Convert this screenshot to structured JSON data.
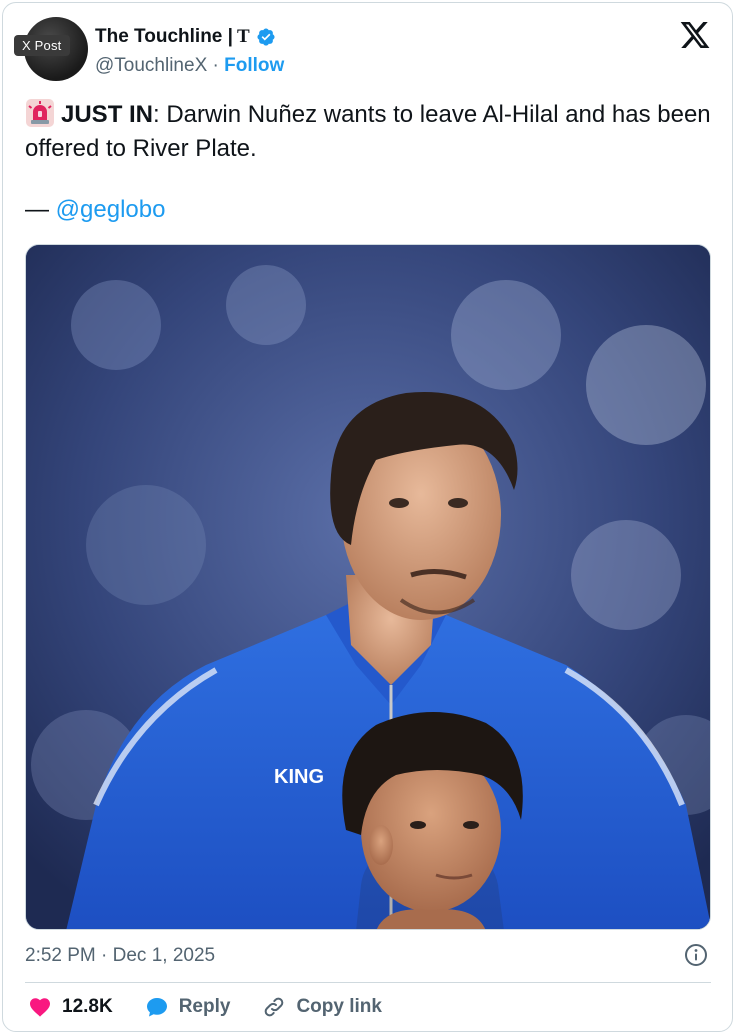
{
  "header": {
    "display_name": "The Touchline |",
    "name_mark": "T",
    "handle": "@TouchlineX",
    "separator": "·",
    "follow_label": "Follow",
    "overlay_tag": "X Post"
  },
  "tweet": {
    "lead": "JUST IN",
    "text": ": Darwin Nuñez wants to leave Al-Hilal and has been offered to River Plate.",
    "dash": "—",
    "mention": "@geglobo"
  },
  "media": {
    "jersey_text": "KING"
  },
  "footer": {
    "timestamp": "2:52 PM · Dec 1, 2025",
    "likes": "12.8K",
    "reply_label": "Reply",
    "copy_label": "Copy link"
  },
  "colors": {
    "accent": "#1d9bf0",
    "like": "#f91880",
    "text": "#0f1419",
    "muted": "#536471"
  }
}
